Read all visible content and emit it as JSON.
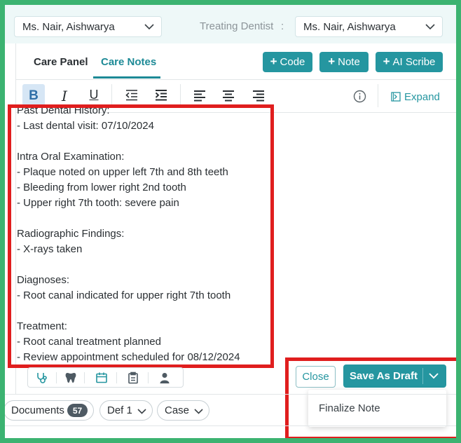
{
  "header": {
    "patient_select": "Ms. Nair, Aishwarya",
    "treating_dentist_label": "Treating Dentist",
    "treating_dentist_colon": ":",
    "dentist_select": "Ms. Nair, Aishwarya"
  },
  "tabs": [
    {
      "label": "Care Panel",
      "active": false
    },
    {
      "label": "Care Notes",
      "active": true
    }
  ],
  "actions": {
    "code": "Code",
    "note": "Note",
    "ai_scribe": "AI Scribe",
    "plus": "+"
  },
  "toolbar": {
    "bold": "B",
    "italic": "I",
    "underline": "U",
    "expand": "Expand"
  },
  "notes": [
    "Past Dental History:",
    "- Last dental visit: 07/10/2024",
    "",
    "Intra Oral Examination:",
    "- Plaque noted on upper left 7th and 8th teeth",
    "- Bleeding from lower right 2nd tooth",
    "- Upper right 7th tooth: severe pain",
    "",
    "Radiographic Findings:",
    "- X-rays taken",
    "",
    "Diagnoses:",
    "- Root canal indicated for upper right 7th tooth",
    "",
    "Treatment:",
    "- Root canal treatment planned",
    "- Review appointment scheduled for 08/12/2024"
  ],
  "footer": {
    "close": "Close",
    "save_as_draft": "Save As Draft",
    "menu_items": [
      "Finalize Note"
    ]
  },
  "bottom_bar": {
    "documents_label": "Documents",
    "documents_count": "57",
    "def_label": "Def 1",
    "case_label": "Case"
  },
  "colors": {
    "accent": "#2596a0",
    "highlight_red": "#e01e1e",
    "outer_border": "#3cb371"
  }
}
